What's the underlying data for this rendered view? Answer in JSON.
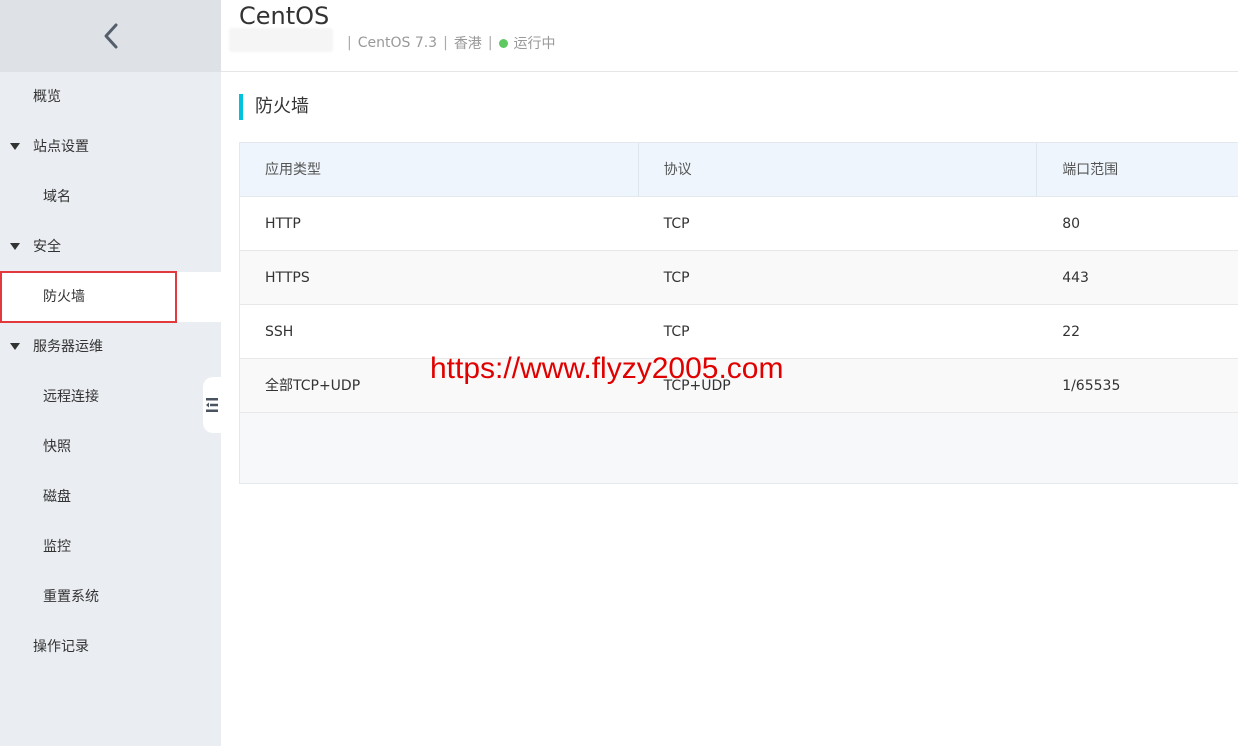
{
  "sidebar": {
    "items": [
      {
        "label": "概览"
      },
      {
        "label": "站点设置"
      },
      {
        "label": "域名"
      },
      {
        "label": "安全"
      },
      {
        "label": "防火墙"
      },
      {
        "label": "服务器运维"
      },
      {
        "label": "远程连接"
      },
      {
        "label": "快照"
      },
      {
        "label": "磁盘"
      },
      {
        "label": "监控"
      },
      {
        "label": "重置系统"
      },
      {
        "label": "操作记录"
      }
    ]
  },
  "header": {
    "title": "CentOS",
    "os": "CentOS 7.3",
    "region": "香港",
    "status": "运行中",
    "separator": "|",
    "status_color": "#5ec861"
  },
  "section": {
    "title": "防火墙",
    "accent_color": "#00c1de"
  },
  "table": {
    "columns": [
      "应用类型",
      "协议",
      "端口范围"
    ],
    "rows": [
      {
        "type": "HTTP",
        "protocol": "TCP",
        "ports": "80"
      },
      {
        "type": "HTTPS",
        "protocol": "TCP",
        "ports": "443"
      },
      {
        "type": "SSH",
        "protocol": "TCP",
        "ports": "22"
      },
      {
        "type": "全部TCP+UDP",
        "protocol": "TCP+UDP",
        "ports": "1/65535"
      }
    ]
  },
  "watermark": "https://www.flyzy2005.com",
  "colors": {
    "highlight": "#e4393c",
    "sidebar_bg": "#eaedf1"
  }
}
